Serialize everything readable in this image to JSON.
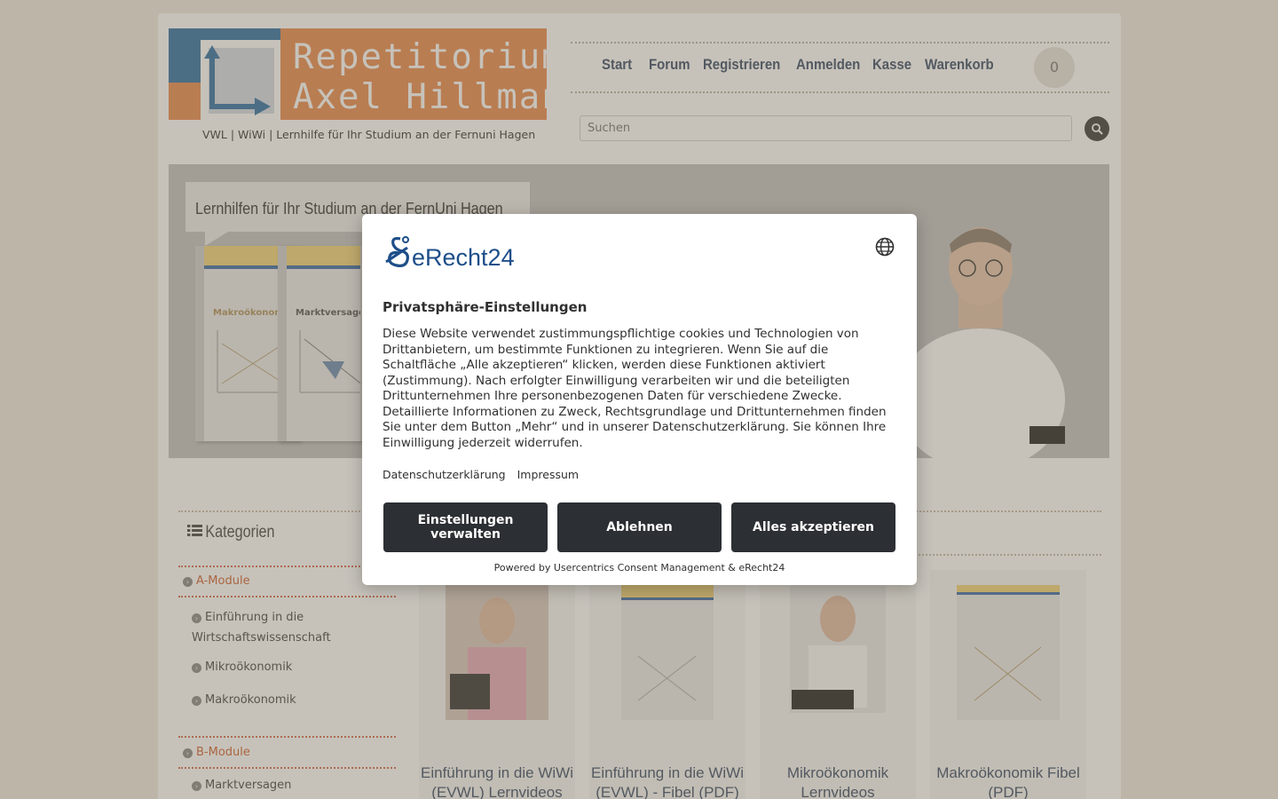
{
  "logo": {
    "line1": "Repetitorium",
    "line2": "Axel Hillmann",
    "tagline": "VWL | WiWi | Lernhilfe für Ihr Studium an der Fernuni Hagen"
  },
  "nav": {
    "items": [
      "Start",
      "Forum",
      "Registrieren",
      "Anmelden",
      "Kasse",
      "Warenkorb"
    ],
    "cart_count": "0"
  },
  "search": {
    "placeholder": "Suchen"
  },
  "banner": {
    "caption": "Lernhilfen für Ihr Studium an der FernUni Hagen",
    "books": [
      "Makroökonomie",
      "Marktversagen"
    ]
  },
  "categories": {
    "heading": "Kategorien",
    "groups": [
      {
        "label": "A-Module",
        "items": [
          "Einführung in die Wirtschaftswissenschaft",
          "Mikroökonomik",
          "Makroökonomik"
        ]
      },
      {
        "label": "B-Module",
        "items": [
          "Marktversagen"
        ]
      }
    ]
  },
  "products": [
    {
      "name": "Einführung in die WiWi (EVWL) Lernvideos"
    },
    {
      "name": "Einführung in die WiWi (EVWL) - Fibel (PDF)"
    },
    {
      "name": "Mikroökonomik Lernvideos"
    },
    {
      "name": "Makroökonomik Fibel (PDF)"
    }
  ],
  "consent": {
    "brand": "eRecht24",
    "title": "Privatsphäre-Einstellungen",
    "body": "Diese Website verwendet zustimmungspflichtige cookies und Technologien von Drittanbietern, um bestimmte Funktionen zu integrieren. Wenn Sie auf die Schaltfläche „Alle akzeptieren“ klicken, werden diese Funktionen aktiviert (Zustimmung). Nach erfolgter Einwilligung verarbeiten wir und die beteiligten Drittunternehmen Ihre personenbezogenen Daten für verschiedene Zwecke. Detaillierte Informationen zu Zweck, Rechtsgrundlage und Drittunternehmen finden Sie unter dem Button „Mehr“ und in unserer Datenschutzerklärung. Sie können Ihre Einwilligung jederzeit widerrufen.",
    "link_privacy": "Datenschutzerklärung",
    "link_imprint": "Impressum",
    "btn_settings": "Einstellungen verwalten",
    "btn_decline": "Ablehnen",
    "btn_accept": "Alles akzeptieren",
    "powered": "Powered by Usercentrics Consent Management & eRecht24"
  },
  "colors": {
    "accent_orange": "#e8894c",
    "accent_blue": "#2e6fa4",
    "button_dark": "#2c2f33"
  }
}
